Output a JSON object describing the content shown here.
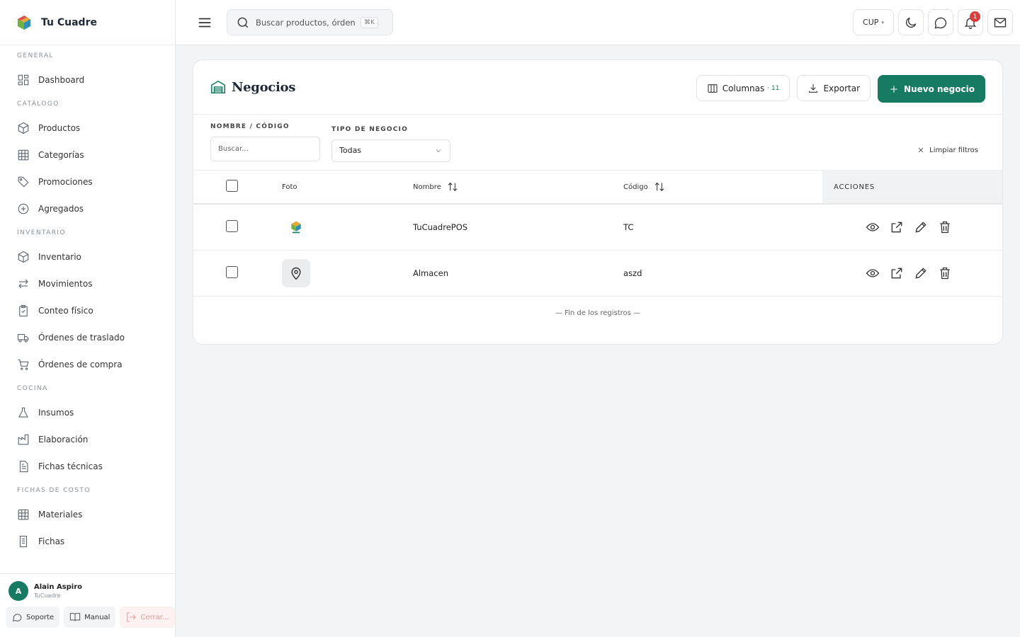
{
  "brand": {
    "name": "Tu Cuadre",
    "accent": "#177b63"
  },
  "sidebar": {
    "sections": [
      {
        "title": "GENERAL",
        "items": [
          {
            "label": "Dashboard",
            "icon": "dashboard-icon"
          }
        ]
      },
      {
        "title": "CATÁLOGO",
        "items": [
          {
            "label": "Productos",
            "icon": "box-icon"
          },
          {
            "label": "Categorías",
            "icon": "grid-icon"
          },
          {
            "label": "Promociones",
            "icon": "tag-icon"
          },
          {
            "label": "Agregados",
            "icon": "plus-circle-icon"
          }
        ]
      },
      {
        "title": "INVENTARIO",
        "items": [
          {
            "label": "Inventario",
            "icon": "box-icon"
          },
          {
            "label": "Movimientos",
            "icon": "arrows-icon"
          },
          {
            "label": "Conteo físico",
            "icon": "clipboard-icon"
          },
          {
            "label": "Órdenes de traslado",
            "icon": "truck-icon"
          },
          {
            "label": "Órdenes de compra",
            "icon": "cart-icon"
          }
        ]
      },
      {
        "title": "COCINA",
        "items": [
          {
            "label": "Insumos",
            "icon": "flask-icon"
          },
          {
            "label": "Elaboración",
            "icon": "factory-icon"
          },
          {
            "label": "Fichas técnicas",
            "icon": "document-icon"
          }
        ]
      },
      {
        "title": "FICHAS DE COSTO",
        "items": [
          {
            "label": "Materiales",
            "icon": "grid-icon"
          },
          {
            "label": "Fichas",
            "icon": "document-icon"
          }
        ]
      }
    ]
  },
  "user": {
    "initial": "A",
    "name": "Alain Aspiro",
    "org": "TuCuadre"
  },
  "user_buttons": {
    "support": "Soporte",
    "manual": "Manual",
    "logout": "Cerrar..."
  },
  "topbar": {
    "search_placeholder": "Buscar productos, órdenes...",
    "shortcut": "⌘K",
    "currency": "CUP",
    "notifications": "1"
  },
  "page": {
    "title": "Negocios",
    "columns_label": "Columnas",
    "columns_count": "· 11",
    "export_label": "Exportar",
    "new_label": "Nuevo negocio"
  },
  "filters": {
    "name_label": "NOMBRE / CÓDIGO",
    "name_placeholder": "Buscar...",
    "type_label": "TIPO DE NEGOCIO",
    "type_value": "Todas",
    "clear_label": "Limpiar filtros"
  },
  "table": {
    "headers": {
      "photo": "Foto",
      "name": "Nombre",
      "code": "Código",
      "actions": "ACCIONES"
    },
    "rows": [
      {
        "name": "TuCuadrePOS",
        "code": "TC",
        "photo": "logo"
      },
      {
        "name": "Almacen",
        "code": "aszd",
        "photo": "location-icon"
      }
    ],
    "end_text": "— Fin de los registros —"
  }
}
